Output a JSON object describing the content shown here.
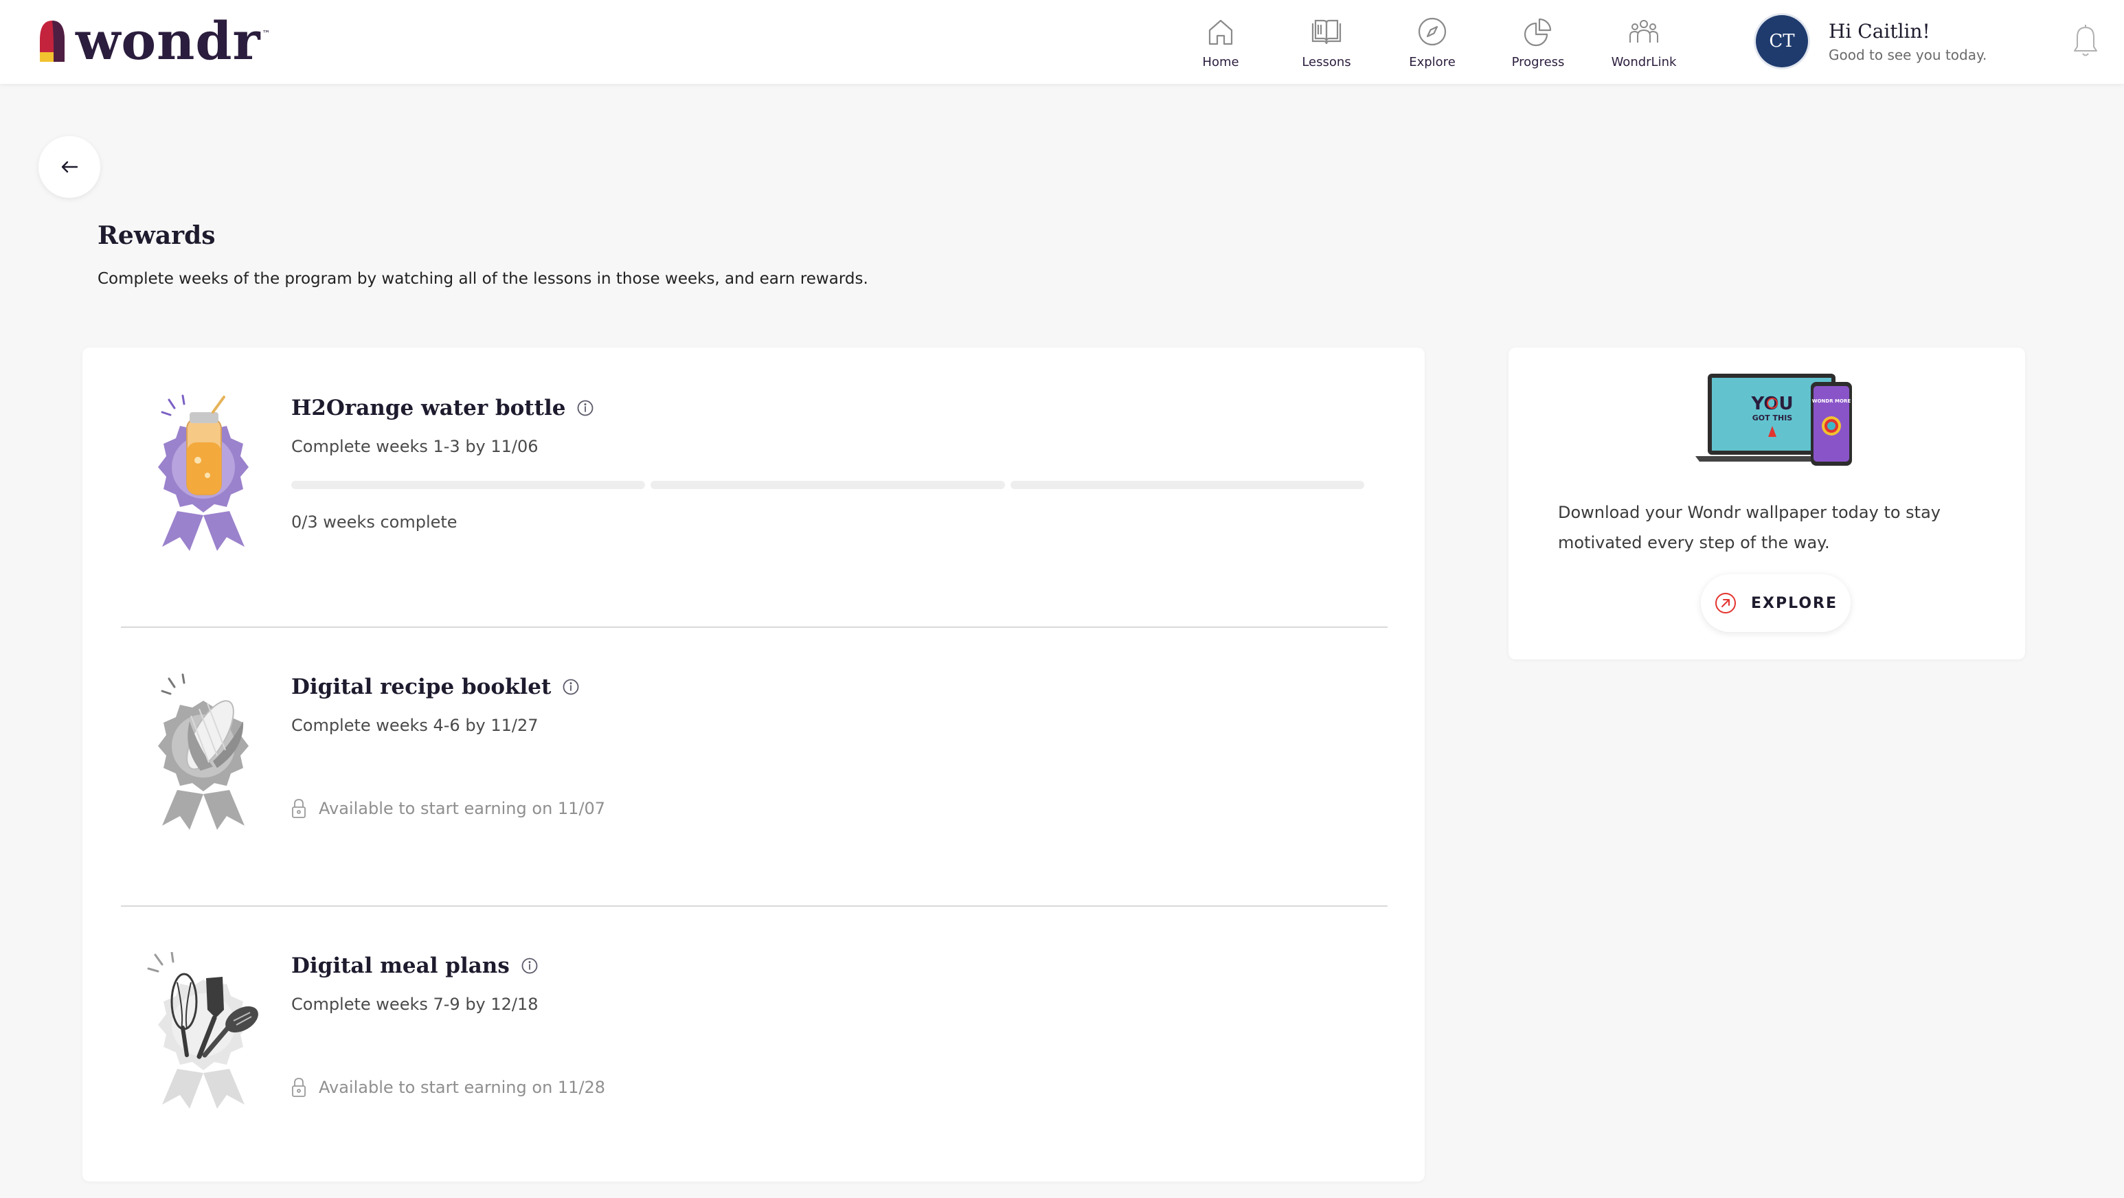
{
  "brand": {
    "name": "wondr",
    "trademark": "™"
  },
  "nav": [
    {
      "label": "Home",
      "icon": "home-icon"
    },
    {
      "label": "Lessons",
      "icon": "book-icon"
    },
    {
      "label": "Explore",
      "icon": "compass-icon"
    },
    {
      "label": "Progress",
      "icon": "pie-chart-icon"
    },
    {
      "label": "WondrLink",
      "icon": "people-icon"
    }
  ],
  "user": {
    "initials": "CT",
    "greeting": "Hi Caitlin!",
    "subtitle": "Good to see you today."
  },
  "page": {
    "title": "Rewards",
    "description": "Complete weeks of the program by watching all of the lessons in those weeks, and earn rewards."
  },
  "rewards": [
    {
      "title": "H2Orange water bottle",
      "subtitle": "Complete weeks 1-3 by 11/06",
      "status": "0/3 weeks complete",
      "weeks_completed": 0,
      "weeks_total": 3,
      "badge_icon": "water-bottle-badge-icon",
      "badge_color": "#9b82cc"
    },
    {
      "title": "Digital recipe booklet",
      "subtitle": "Complete weeks 4-6 by 11/27",
      "locked_text": "Available to start earning on 11/07",
      "badge_icon": "corn-badge-icon"
    },
    {
      "title": "Digital meal plans",
      "subtitle": "Complete weeks 7-9 by 12/18",
      "locked_text": "Available to start earning on 11/28",
      "badge_icon": "utensils-badge-icon"
    }
  ],
  "promo": {
    "text": "Download your Wondr wallpaper today to stay motivated every step of the way.",
    "button_label": "EXPLORE",
    "image": {
      "laptop_text_1": "YOU",
      "laptop_text_2": "GOT THIS",
      "phone_text": "WONDR MORE"
    }
  },
  "colors": {
    "accent": "#e3342f",
    "brand_dark": "#2b1d3d",
    "avatar": "#1f3b6e",
    "badge_purple": "#9b82cc"
  }
}
